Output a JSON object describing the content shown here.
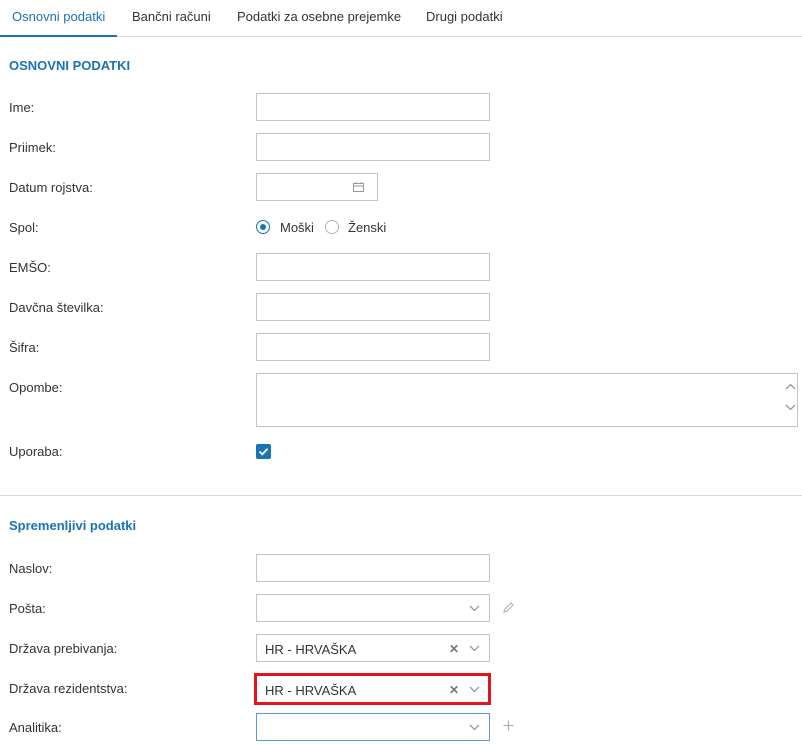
{
  "tabs": [
    {
      "label": "Osnovni podatki"
    },
    {
      "label": "Bančni računi"
    },
    {
      "label": "Podatki za osebne prejemke"
    },
    {
      "label": "Drugi podatki"
    }
  ],
  "section1": {
    "title": "OSNOVNI PODATKI",
    "fields": {
      "ime": {
        "label": "Ime:",
        "value": ""
      },
      "priimek": {
        "label": "Priimek:",
        "value": ""
      },
      "datum": {
        "label": "Datum rojstva:",
        "value": ""
      },
      "spol": {
        "label": "Spol:",
        "options": [
          "Moški",
          "Ženski"
        ],
        "selected": "Moški"
      },
      "emso": {
        "label": "EMŠO:",
        "value": ""
      },
      "davcna": {
        "label": "Davčna številka:",
        "value": ""
      },
      "sifra": {
        "label": "Šifra:",
        "value": ""
      },
      "opombe": {
        "label": "Opombe:",
        "value": ""
      },
      "uporaba": {
        "label": "Uporaba:",
        "checked": true
      }
    }
  },
  "section2": {
    "title": "Spremenljivi podatki",
    "fields": {
      "naslov": {
        "label": "Naslov:",
        "value": ""
      },
      "posta": {
        "label": "Pošta:",
        "value": ""
      },
      "drzava_prebivanja": {
        "label": "Država prebivanja:",
        "value": "HR - HRVAŠKA"
      },
      "drzava_rezidentstva": {
        "label": "Država rezidentstva:",
        "value": "HR - HRVAŠKA"
      },
      "analitika": {
        "label": "Analitika:",
        "value": ""
      }
    }
  },
  "colors": {
    "accent": "#1a73b5",
    "highlight": "#e3141d",
    "border": "#c4c4c4"
  },
  "icons": {
    "calendar": "calendar-icon",
    "chevron": "chevron-down-icon",
    "clear": "clear-icon",
    "edit": "pencil-icon",
    "add": "plus-icon",
    "check": "checkmark-icon"
  }
}
